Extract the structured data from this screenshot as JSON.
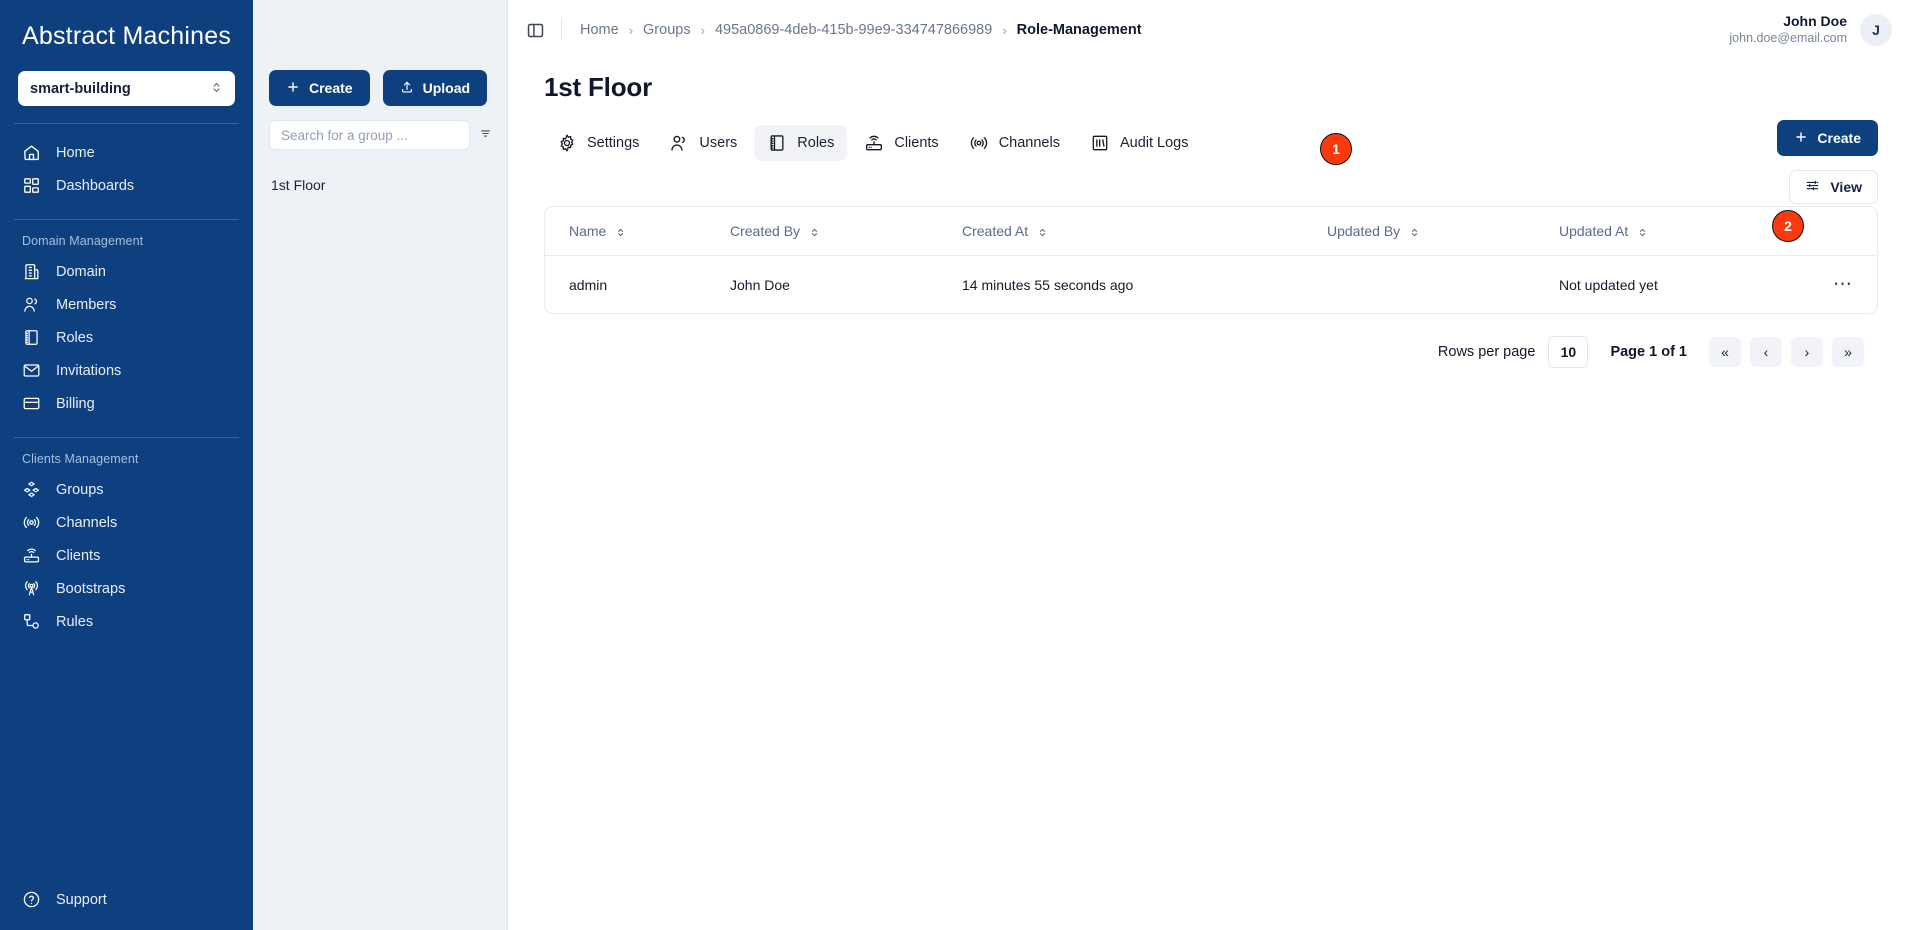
{
  "sidebar": {
    "brand": "Abstract Machines",
    "domain_value": "smart-building",
    "nav_top": [
      {
        "label": "Home",
        "icon": "home-icon"
      },
      {
        "label": "Dashboards",
        "icon": "dashboards-icon"
      }
    ],
    "group1_label": "Domain Management",
    "nav_domain": [
      {
        "label": "Domain",
        "icon": "building-icon"
      },
      {
        "label": "Members",
        "icon": "members-icon"
      },
      {
        "label": "Roles",
        "icon": "roles-icon"
      },
      {
        "label": "Invitations",
        "icon": "envelope-icon"
      },
      {
        "label": "Billing",
        "icon": "card-icon"
      }
    ],
    "group2_label": "Clients Management",
    "nav_clients": [
      {
        "label": "Groups",
        "icon": "groups-icon"
      },
      {
        "label": "Channels",
        "icon": "channels-icon"
      },
      {
        "label": "Clients",
        "icon": "router-icon"
      },
      {
        "label": "Bootstraps",
        "icon": "bootstraps-icon"
      },
      {
        "label": "Rules",
        "icon": "rules-icon"
      }
    ],
    "support_label": "Support"
  },
  "group_panel": {
    "create_label": "Create",
    "upload_label": "Upload",
    "search_placeholder": "Search for a group ...",
    "search_value": "",
    "filter_icon": "filter-icon",
    "items": [
      {
        "label": "1st Floor"
      }
    ]
  },
  "topbar": {
    "toggle_icon": "sidebar-toggle-icon",
    "breadcrumbs": [
      {
        "label": "Home",
        "active": false
      },
      {
        "label": "Groups",
        "active": false
      },
      {
        "label": "495a0869-4deb-415b-99e9-334747866989",
        "active": false
      },
      {
        "label": "Role-Management",
        "active": true
      }
    ],
    "user_name": "John Doe",
    "user_email": "john.doe@email.com",
    "avatar_initial": "J"
  },
  "main": {
    "page_title": "1st Floor",
    "tabs": [
      {
        "label": "Settings",
        "icon": "gear-icon",
        "active": false
      },
      {
        "label": "Users",
        "icon": "users-icon",
        "active": false
      },
      {
        "label": "Roles",
        "icon": "roles-icon",
        "active": true
      },
      {
        "label": "Clients",
        "icon": "router-icon",
        "active": false
      },
      {
        "label": "Channels",
        "icon": "channels-icon",
        "active": false
      },
      {
        "label": "Audit Logs",
        "icon": "audit-icon",
        "active": false
      }
    ],
    "create_label": "Create",
    "view_label": "View",
    "badges": [
      {
        "value": "1"
      },
      {
        "value": "2"
      }
    ],
    "table": {
      "columns": [
        "Name",
        "Created By",
        "Created At",
        "Updated By",
        "Updated At"
      ],
      "rows": [
        {
          "name": "admin",
          "created_by": "John Doe",
          "created_at": "14 minutes 55 seconds ago",
          "updated_by": "",
          "updated_at": "Not updated yet",
          "menu_icon": "ellipsis-icon"
        }
      ]
    },
    "pagination": {
      "rows_per_page_label": "Rows per page",
      "rows_per_page_value": "10",
      "page_label": "Page 1 of 1",
      "first_label": "«",
      "prev_label": "‹",
      "next_label": "›",
      "last_label": "»"
    }
  },
  "colors": {
    "sidebar_bg": "#0e3f7e",
    "panel_bg": "#eef1f6",
    "badge_red": "#f93a0e",
    "primary": "#0e3f7e"
  }
}
